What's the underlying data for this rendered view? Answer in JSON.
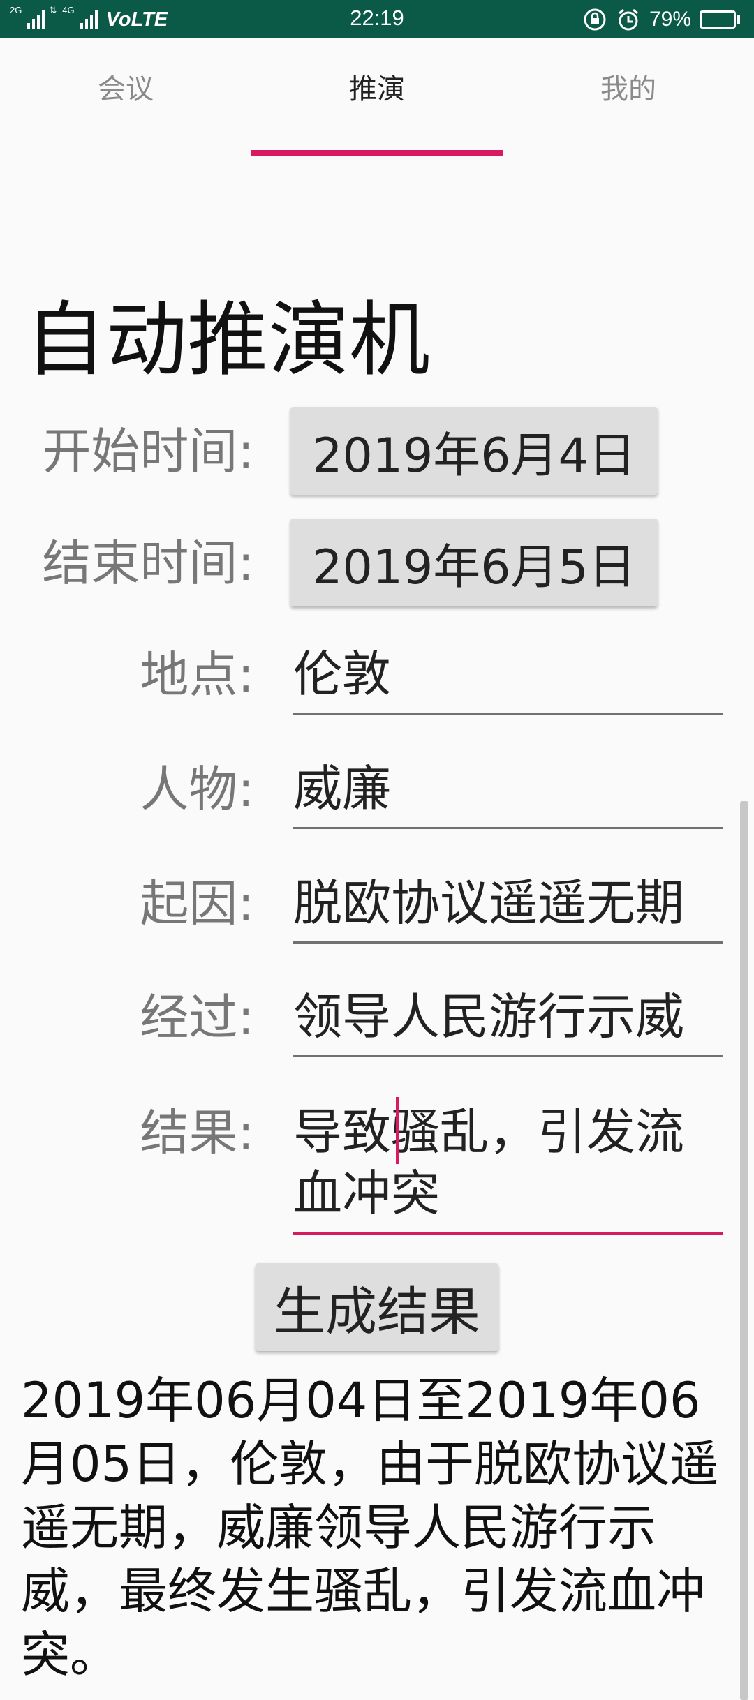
{
  "status_bar": {
    "net_tag_1": "2G",
    "net_tag_2": "4G",
    "volte": "VoLTE",
    "time": "22:19",
    "battery": "79%",
    "battery_level": 0.79,
    "icons": [
      "signal-icon",
      "data-arrows-icon",
      "lock-rotation-icon",
      "alarm-icon",
      "battery-icon"
    ]
  },
  "tabs": [
    {
      "label": "会议",
      "active": false
    },
    {
      "label": "推演",
      "active": true
    },
    {
      "label": "我的",
      "active": false
    }
  ],
  "accent_color": "#d81b60",
  "status_bar_color": "#0b5a47",
  "page_title": "自动推演机",
  "form": {
    "start_label": "开始时间:",
    "start_value": "2019年6月4日",
    "end_label": "结束时间:",
    "end_value": "2019年6月5日",
    "place_label": "地点:",
    "place_value": "伦敦",
    "person_label": "人物:",
    "person_value": "威廉",
    "cause_label": "起因:",
    "cause_value": "脱欧协议遥遥无期",
    "process_label": "经过:",
    "process_value": "领导人民游行示威",
    "outcome_label": "结果:",
    "outcome_value": "导致骚乱，引发流血冲突"
  },
  "generate_button": "生成结果",
  "result_text": "2019年06月04日至2019年06月05日，伦敦，由于脱欧协议遥遥无期，威廉领导人民游行示威，最终发生骚乱，引发流血冲突。"
}
